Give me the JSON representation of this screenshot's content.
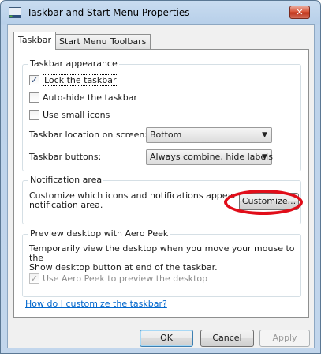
{
  "window": {
    "title": "Taskbar and Start Menu Properties",
    "close_glyph": "✕",
    "title_icon": "taskbar-app-icon"
  },
  "tabs": [
    {
      "label": "Taskbar",
      "active": true
    },
    {
      "label": "Start Menu",
      "active": false
    },
    {
      "label": "Toolbars",
      "active": false
    }
  ],
  "taskbar_appearance": {
    "title": "Taskbar appearance",
    "lock": {
      "label": "Lock the taskbar",
      "checked": true
    },
    "autohide": {
      "label": "Auto-hide the taskbar",
      "checked": false
    },
    "small_icons": {
      "label": "Use small icons",
      "checked": false
    },
    "location_label": "Taskbar location on screen:",
    "location_value": "Bottom",
    "buttons_label": "Taskbar buttons:",
    "buttons_value": "Always combine, hide labels"
  },
  "notification_area": {
    "title": "Notification area",
    "description_line1": "Customize which icons and notifications appear in the",
    "description_line2": "notification area.",
    "customize_button": "Customize..."
  },
  "aero_peek": {
    "title": "Preview desktop with Aero Peek",
    "description_line1": "Temporarily view the desktop when you move your mouse to the",
    "description_line2": "Show desktop button at end of the taskbar.",
    "checkbox": {
      "label": "Use Aero Peek to preview the desktop",
      "checked": true,
      "disabled": true
    }
  },
  "help_link": "How do I customize the taskbar?",
  "buttons": {
    "ok": "OK",
    "cancel": "Cancel",
    "apply": "Apply"
  },
  "check_glyph": "✓",
  "dropdown_glyph": "▼",
  "colors": {
    "highlight_ellipse": "#e10d19",
    "link": "#0066cc",
    "title_bar": "#b7cfe9"
  }
}
